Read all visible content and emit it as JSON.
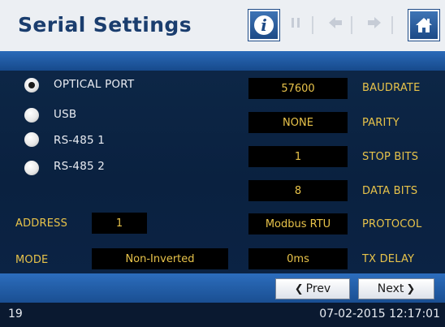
{
  "header": {
    "title": "Serial Settings",
    "info_glyph": "i"
  },
  "ports": [
    {
      "label": "OPTICAL PORT",
      "selected": true
    },
    {
      "label": "USB",
      "selected": false
    },
    {
      "label": "RS-485 1",
      "selected": false
    },
    {
      "label": "RS-485 2",
      "selected": false
    }
  ],
  "fields": {
    "address": {
      "label": "ADDRESS",
      "value": "1"
    },
    "mode": {
      "label": "MODE",
      "value": "Non-Inverted"
    },
    "baudrate": {
      "label": "BAUDRATE",
      "value": "57600"
    },
    "parity": {
      "label": "PARITY",
      "value": "NONE"
    },
    "stop_bits": {
      "label": "STOP BITS",
      "value": "1"
    },
    "data_bits": {
      "label": "DATA BITS",
      "value": "8"
    },
    "protocol": {
      "label": "PROTOCOL",
      "value": "Modbus RTU"
    },
    "tx_delay": {
      "label": "TX DELAY",
      "value": "0ms"
    }
  },
  "navigation": {
    "prev_label": "Prev",
    "next_label": "Next"
  },
  "status": {
    "page_number": "19",
    "datetime": "07-02-2015 12:17:01"
  },
  "colors": {
    "header_bg": "#eceff3",
    "title": "#1a3d6e",
    "accent_blue": "#1d4a86",
    "field_text": "#e8c34a",
    "value_bg": "#000000",
    "screen_bg": "#0a2140"
  },
  "icons": [
    "info-icon",
    "pause-icon",
    "back-arrow-icon",
    "forward-arrow-icon",
    "home-icon"
  ]
}
